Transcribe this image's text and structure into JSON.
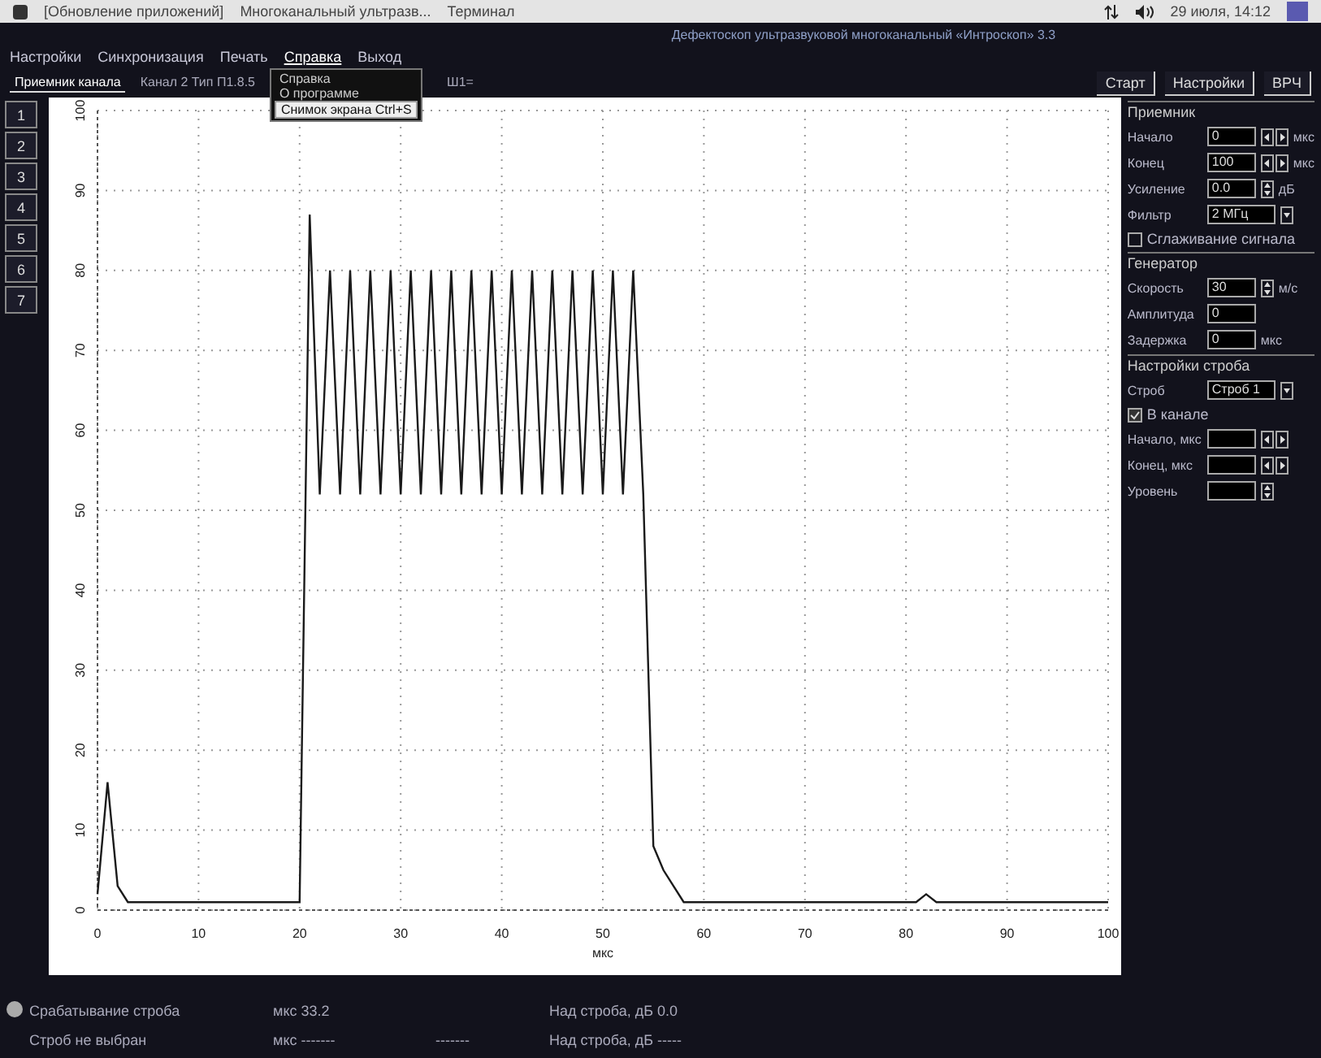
{
  "taskbar": {
    "items": [
      {
        "label": "[Обновление приложений]"
      },
      {
        "label": "Многоканальный ультразв..."
      },
      {
        "label": "Терминал"
      }
    ],
    "clock": "29 июля, 14:12"
  },
  "window": {
    "title": "Дефектоскоп ультразвуковой многоканальный «Интроскоп» 3.3"
  },
  "menu": [
    {
      "label": "Настройки",
      "selected": false
    },
    {
      "label": "Синхронизация",
      "selected": false
    },
    {
      "label": "Печать",
      "selected": false
    },
    {
      "label": "Справка",
      "selected": true
    },
    {
      "label": "Выход",
      "selected": false
    }
  ],
  "tabs": [
    {
      "label": "Приемник канала",
      "selected": true
    },
    {
      "label": "Канал 2 Тип П1.8.5",
      "selected": false
    },
    {
      "label": "Ш1=",
      "selected": false
    }
  ],
  "dropdown": [
    {
      "label": "Справка",
      "selected": false
    },
    {
      "label": "О программе",
      "selected": false
    },
    {
      "label": "Снимок экрана  Ctrl+S",
      "selected": true
    }
  ],
  "toolbar_buttons": [
    "Старт",
    "Настройки",
    "ВРЧ"
  ],
  "channel_buttons": [
    "1",
    "2",
    "3",
    "4",
    "5",
    "6",
    "7"
  ],
  "chart_data": {
    "type": "line",
    "grid": true,
    "xlabel": "мкс",
    "xlim": [
      0,
      100
    ],
    "ylim": [
      0,
      100
    ],
    "xticks": [
      0,
      10,
      20,
      30,
      40,
      50,
      60,
      70,
      80,
      90,
      100
    ],
    "yticks": [
      0,
      10,
      20,
      30,
      40,
      50,
      60,
      70,
      80,
      90,
      100
    ],
    "x": [
      0,
      1,
      2,
      3,
      4,
      5,
      6,
      7,
      8,
      9,
      10,
      11,
      12,
      13,
      14,
      15,
      16,
      17,
      18,
      19,
      20,
      21,
      22,
      23,
      24,
      25,
      26,
      27,
      28,
      29,
      30,
      31,
      32,
      33,
      34,
      35,
      36,
      37,
      38,
      39,
      40,
      41,
      42,
      43,
      44,
      45,
      46,
      47,
      48,
      49,
      50,
      51,
      52,
      53,
      54,
      55,
      56,
      57,
      58,
      59,
      60,
      61,
      62,
      63,
      64,
      65,
      66,
      67,
      68,
      69,
      70,
      71,
      72,
      73,
      74,
      75,
      76,
      77,
      78,
      79,
      80,
      81,
      82,
      83,
      84,
      85,
      86,
      87,
      88,
      89,
      90,
      91,
      92,
      93,
      94,
      95,
      96,
      97,
      98,
      99,
      100
    ],
    "series": [
      {
        "color": "#1a1a1a",
        "values": [
          2,
          16,
          3,
          1,
          1,
          1,
          1,
          1,
          1,
          1,
          1,
          1,
          1,
          1,
          1,
          1,
          1,
          1,
          1,
          1,
          1,
          87,
          52,
          80,
          52,
          80,
          52,
          80,
          52,
          80,
          52,
          80,
          52,
          80,
          52,
          80,
          52,
          80,
          52,
          80,
          52,
          80,
          52,
          80,
          52,
          80,
          52,
          80,
          52,
          80,
          52,
          80,
          52,
          80,
          52,
          8,
          5,
          3,
          1,
          1,
          1,
          1,
          1,
          1,
          1,
          1,
          1,
          1,
          1,
          1,
          1,
          1,
          1,
          1,
          1,
          1,
          1,
          1,
          1,
          1,
          1,
          1,
          2,
          1,
          1,
          1,
          1,
          1,
          1,
          1,
          1,
          1,
          1,
          1,
          1,
          1,
          1,
          1,
          1,
          1,
          1
        ]
      }
    ]
  },
  "panel": {
    "sections": [
      {
        "title": "Приемник",
        "fields": [
          {
            "kind": "spin",
            "label": "Начало",
            "value": "0",
            "unit": "мкс"
          },
          {
            "kind": "spin",
            "label": "Конец",
            "value": "100",
            "unit": "мкс"
          },
          {
            "kind": "updown",
            "label": "Усиление",
            "value": "0.0",
            "unit": "дБ"
          },
          {
            "kind": "combo",
            "label": "Фильтр",
            "value": "2 МГц"
          },
          {
            "kind": "check",
            "label": "Сглаживание сигнала",
            "checked": false
          }
        ]
      },
      {
        "title": "Генератор",
        "fields": [
          {
            "kind": "updown",
            "label": "Скорость",
            "value": "30",
            "unit": "м/с"
          },
          {
            "kind": "text",
            "label": "Амплитуда",
            "value": "0"
          },
          {
            "kind": "text",
            "label": "Задержка",
            "value": "0",
            "unit": "мкс"
          }
        ]
      },
      {
        "title": "Настройки строба",
        "fields": [
          {
            "kind": "combo",
            "label": "Строб",
            "value": "Строб 1"
          },
          {
            "kind": "check",
            "label": "В канале",
            "checked": true
          },
          {
            "kind": "spin",
            "label": "Начало, мкс"
          },
          {
            "kind": "spin",
            "label": "Конец, мкс"
          },
          {
            "kind": "updown",
            "label": "Уровень"
          }
        ]
      }
    ]
  },
  "status": {
    "indicator_on": false,
    "rows": [
      {
        "label": "Срабатывание строба",
        "time": "мкс 33.2",
        "db": "Над строба, дБ 0.0"
      },
      {
        "label": "Строб не выбран",
        "time": "мкс -------",
        "extra": "-------",
        "db": "Над строба, дБ -----"
      }
    ]
  }
}
